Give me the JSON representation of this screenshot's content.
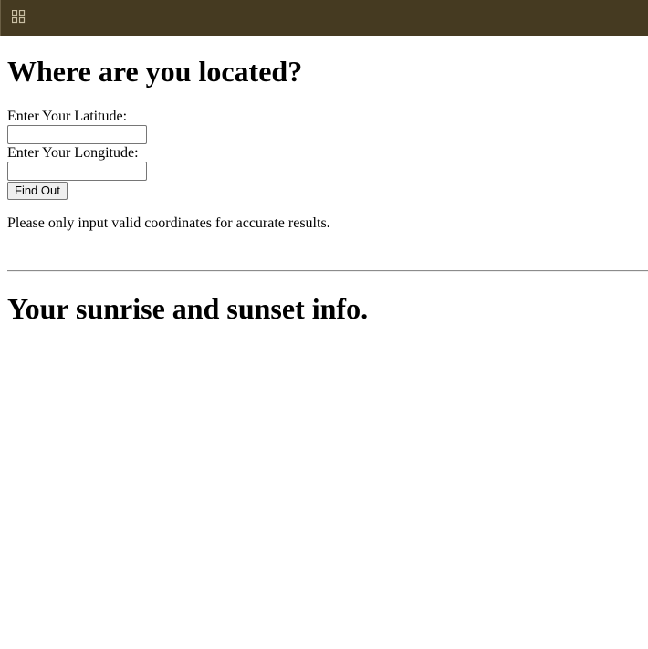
{
  "header": {
    "apps_icon": "grid-apps-icon",
    "background_color": "#453a21",
    "icon_color": "#c9bfa4"
  },
  "location_form": {
    "heading": "Where are you located?",
    "latitude_label": "Enter Your Latitude:",
    "latitude_value": "",
    "longitude_label": "Enter Your Longitude:",
    "longitude_value": "",
    "submit_label": "Find Out",
    "note": "Please only input valid coordinates for accurate results."
  },
  "results": {
    "heading": "Your sunrise and sunset info."
  }
}
